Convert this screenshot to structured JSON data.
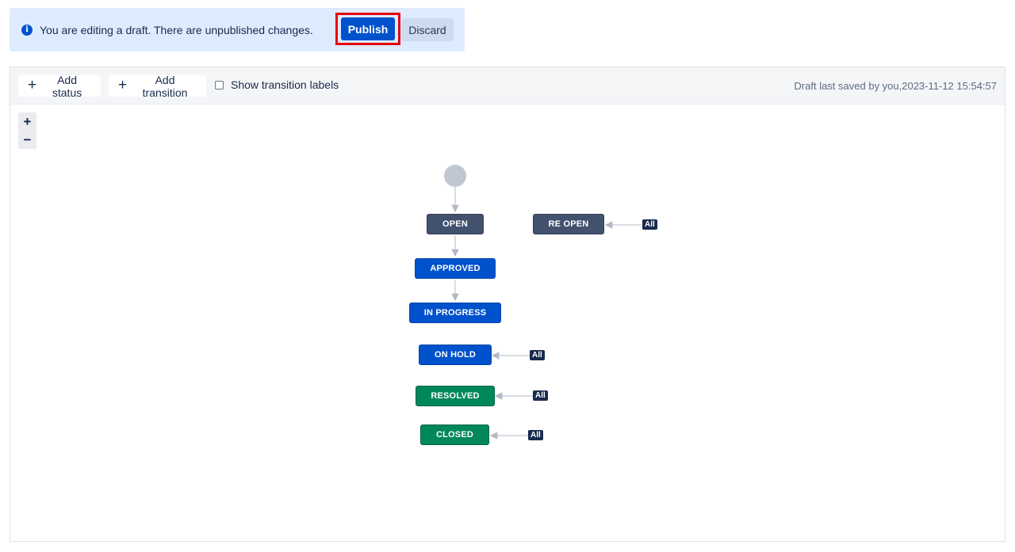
{
  "banner": {
    "message": "You are editing a draft. There are unpublished changes.",
    "info_icon": "info-icon",
    "publish_label": "Publish",
    "discard_label": "Discard",
    "bg_color": "#deebff",
    "publish_color": "#0052cc",
    "highlight_color": "#e3000f"
  },
  "toolbar": {
    "add_status_label": "Add status",
    "add_transition_label": "Add transition",
    "show_labels_label": "Show transition labels",
    "show_labels_checked": false,
    "saved_text": "Draft last saved by you,2023-11-12 15:54:57"
  },
  "zoom": {
    "in_label": "+",
    "out_label": "−"
  },
  "workflow": {
    "statuses": [
      {
        "id": "open",
        "label": "OPEN",
        "category": "todo"
      },
      {
        "id": "reopen",
        "label": "RE OPEN",
        "category": "todo"
      },
      {
        "id": "approved",
        "label": "APPROVED",
        "category": "progress"
      },
      {
        "id": "in_progress",
        "label": "IN PROGRESS",
        "category": "progress"
      },
      {
        "id": "on_hold",
        "label": "ON HOLD",
        "category": "progress"
      },
      {
        "id": "resolved",
        "label": "RESOLVED",
        "category": "done"
      },
      {
        "id": "closed",
        "label": "CLOSED",
        "category": "done"
      }
    ],
    "global_transition_label": "All",
    "category_colors": {
      "todo": "#42526e",
      "progress": "#0052cc",
      "done": "#00875a"
    }
  }
}
